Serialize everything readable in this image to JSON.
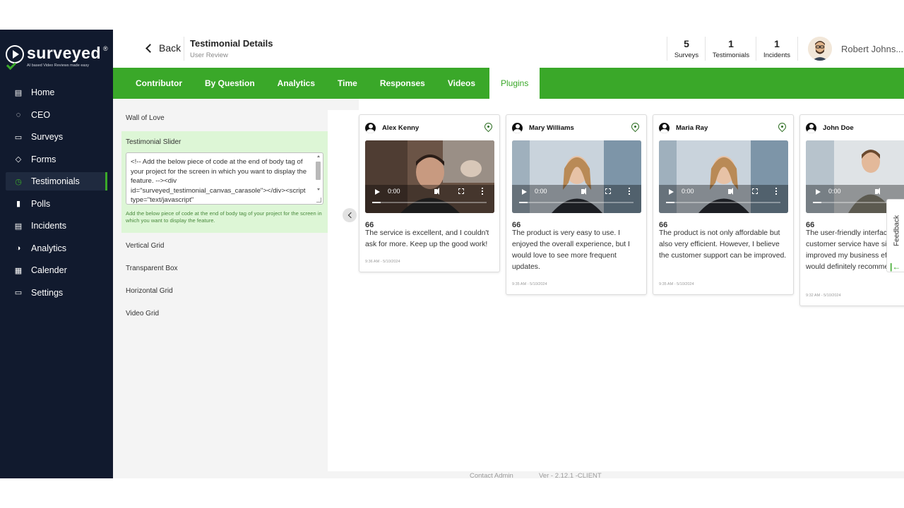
{
  "app": {
    "logo_text": "surveyed",
    "logo_reg": "®",
    "logo_tagline": "AI based Video Reviews made easy"
  },
  "sidebar": {
    "items": [
      {
        "label": "Home",
        "icon": "home-icon",
        "glyph": "▤",
        "active": false
      },
      {
        "label": "CEO",
        "icon": "ceo-icon",
        "glyph": "◌",
        "active": false
      },
      {
        "label": "Surveys",
        "icon": "surveys-icon",
        "glyph": "▭",
        "active": false
      },
      {
        "label": "Forms",
        "icon": "forms-icon",
        "glyph": "◇",
        "active": false
      },
      {
        "label": "Testimonials",
        "icon": "testimonials-icon",
        "glyph": "◷",
        "active": true
      },
      {
        "label": "Polls",
        "icon": "polls-icon",
        "glyph": "▮",
        "active": false
      },
      {
        "label": "Incidents",
        "icon": "incidents-icon",
        "glyph": "▤",
        "active": false
      },
      {
        "label": "Analytics",
        "icon": "analytics-icon",
        "glyph": "◑",
        "active": false
      },
      {
        "label": "Calender",
        "icon": "calendar-icon",
        "glyph": "▦",
        "active": false
      },
      {
        "label": "Settings",
        "icon": "settings-icon",
        "glyph": "▭",
        "active": false
      }
    ]
  },
  "header": {
    "back_label": "Back",
    "title": "Testimonial Details",
    "subtitle": "User Review",
    "stats": [
      {
        "num": "5",
        "label": "Surveys"
      },
      {
        "num": "1",
        "label": "Testimonials"
      },
      {
        "num": "1",
        "label": "Incidents"
      }
    ],
    "user_name": "Robert Johns..."
  },
  "tabs": [
    {
      "label": "Contributor",
      "active": false
    },
    {
      "label": "By Question",
      "active": false
    },
    {
      "label": "Analytics",
      "active": false
    },
    {
      "label": "Time",
      "active": false
    },
    {
      "label": "Responses",
      "active": false
    },
    {
      "label": "Videos",
      "active": false
    },
    {
      "label": "Plugins",
      "active": true
    }
  ],
  "plugins": {
    "wall_of_love": "Wall of Love",
    "testimonial_slider": "Testimonial Slider",
    "code": "<!-- Add the below piece of code at the end of body tag of your project for the screen in which you want to display the feature. --><div id=\"surveyed_testimonial_canvas_carasole\"></div><script type=\"text/javascript\"",
    "hint": "Add the below piece of code at the end of body tag of your project for the screen in which you want to display the feature.",
    "vertical_grid": "Vertical Grid",
    "transparent_box": "Transparent Box",
    "horizontal_grid": "Horizontal Grid",
    "video_grid": "Video Grid"
  },
  "testimonials": [
    {
      "name": "Alex Kenny",
      "time": "0:00",
      "quote_mark": "66",
      "text": "The service is excellent, and I couldn't ask for more. Keep up the good work!",
      "date": "9:36 AM - 5/10/2024"
    },
    {
      "name": "Mary Williams",
      "time": "0:00",
      "quote_mark": "66",
      "text": "The product is very easy to use. I enjoyed the overall experience, but I would love to see more frequent updates.",
      "date": "9:35 AM - 5/10/2024"
    },
    {
      "name": "Maria Ray",
      "time": "0:00",
      "quote_mark": "66",
      "text": "The product is not only affordable but also very efficient. However, I believe the customer support can be improved.",
      "date": "9:35 AM - 5/10/2024"
    },
    {
      "name": "John Doe",
      "time": "0:00",
      "quote_mark": "66",
      "text": "The user-friendly interface and excellent customer service have significantly improved my business efficiency. I would definitely recommend it to others.",
      "date": "9:32 AM - 5/10/2024"
    }
  ],
  "feedback": {
    "label": "Feedback",
    "arrow": "|←"
  },
  "footer": {
    "contact": "Contact Admin",
    "version": "Ver - 2.12.1 -CLIENT"
  },
  "colors": {
    "brand_green": "#3aa829",
    "sidebar_bg": "#111a2e",
    "active_panel": "#ddf6d6"
  }
}
